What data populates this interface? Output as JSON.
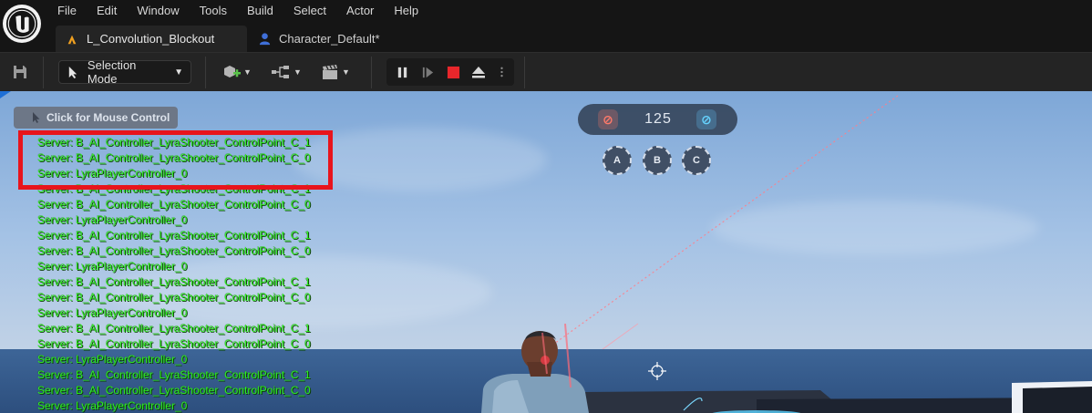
{
  "menu": {
    "items": [
      "File",
      "Edit",
      "Window",
      "Tools",
      "Build",
      "Select",
      "Actor",
      "Help"
    ]
  },
  "tabs": {
    "level_tab": "L_Convolution_Blockout",
    "character_tab": "Character_Default*"
  },
  "toolbar": {
    "selection_mode": "Selection Mode"
  },
  "viewport": {
    "mouse_control_hint": "Click for Mouse Control",
    "log_lines": [
      "Server: B_AI_Controller_LyraShooter_ControlPoint_C_1",
      "Server: B_AI_Controller_LyraShooter_ControlPoint_C_0",
      "Server: LyraPlayerController_0",
      "Server: B_AI_Controller_LyraShooter_ControlPoint_C_1",
      "Server: B_AI_Controller_LyraShooter_ControlPoint_C_0",
      "Server: LyraPlayerController_0",
      "Server: B_AI_Controller_LyraShooter_ControlPoint_C_1",
      "Server: B_AI_Controller_LyraShooter_ControlPoint_C_0",
      "Server: LyraPlayerController_0",
      "Server: B_AI_Controller_LyraShooter_ControlPoint_C_1",
      "Server: B_AI_Controller_LyraShooter_ControlPoint_C_0",
      "Server: LyraPlayerController_0",
      "Server: B_AI_Controller_LyraShooter_ControlPoint_C_1",
      "Server: B_AI_Controller_LyraShooter_ControlPoint_C_0",
      "Server: LyraPlayerController_0",
      "Server: B_AI_Controller_LyraShooter_ControlPoint_C_1",
      "Server: B_AI_Controller_LyraShooter_ControlPoint_C_0",
      "Server: LyraPlayerController_0"
    ],
    "hud": {
      "score": "125",
      "control_points": [
        "A",
        "B",
        "C"
      ],
      "red_team_color": "#ff7a6a",
      "blue_team_color": "#66d4ff"
    },
    "highlight_color": "#e8141c",
    "log_color": "#2ef01f"
  }
}
